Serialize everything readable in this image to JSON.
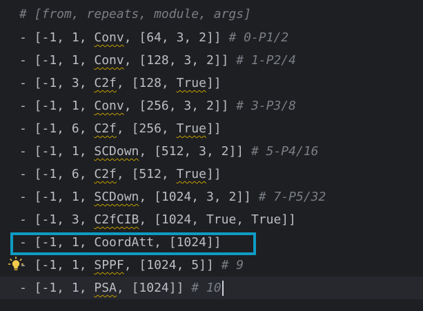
{
  "header_comment": "# [from, repeats, module, args]",
  "rows": [
    {
      "prefix": "- [-1, 1, ",
      "module": "Conv",
      "args": ", [64, 3, 2]]",
      "comment": " # 0-P1/2"
    },
    {
      "prefix": "- [-1, 1, ",
      "module": "Conv",
      "args": ", [128, 3, 2]]",
      "comment": " # 1-P2/4"
    },
    {
      "prefix": "- [-1, 3, ",
      "module": "C2f",
      "args_pre": ", [128, ",
      "flag": "True",
      "args_post": "]]"
    },
    {
      "prefix": "- [-1, 1, ",
      "module": "Conv",
      "args": ", [256, 3, 2]]",
      "comment": " # 3-P3/8"
    },
    {
      "prefix": "- [-1, 6, ",
      "module": "C2f",
      "args_pre": ", [256, ",
      "flag": "True",
      "args_post": "]]"
    },
    {
      "prefix": "- [-1, 1, ",
      "module": "SCDown",
      "args": ", [512, 3, 2]]",
      "comment": " # 5-P4/16"
    },
    {
      "prefix": "- [-1, 6, ",
      "module": "C2f",
      "args_pre": ", [512, ",
      "flag": "True",
      "args_post": "]]"
    },
    {
      "prefix": "- [-1, 1, ",
      "module": "SCDown",
      "args": ", [1024, 3, 2]]",
      "comment": " # 7-P5/32"
    },
    {
      "prefix": "- [-1, 3, ",
      "module": "C2fCIB",
      "args": ", [1024, True, True]]"
    },
    {
      "prefix": "- [-1, 1, ",
      "module": "CoordAtt",
      "args": ", [1024]]"
    },
    {
      "prefix": "- [-1, 1, ",
      "module": "SPPF",
      "args": ", [1024, 5]]",
      "comment": " # 9"
    },
    {
      "prefix": "- [-1, 1, ",
      "module": "PSA",
      "args": ", [1024]]",
      "comment": " # 10"
    }
  ],
  "colors": {
    "background": "#1e1f22",
    "text": "#bcbec4",
    "comment": "#7a7e85",
    "highlight": "#0e9bc4",
    "squiggle": "#c4a000",
    "bulb": "#f2c94c"
  },
  "icons": {
    "gutter": "lightbulb-icon"
  }
}
